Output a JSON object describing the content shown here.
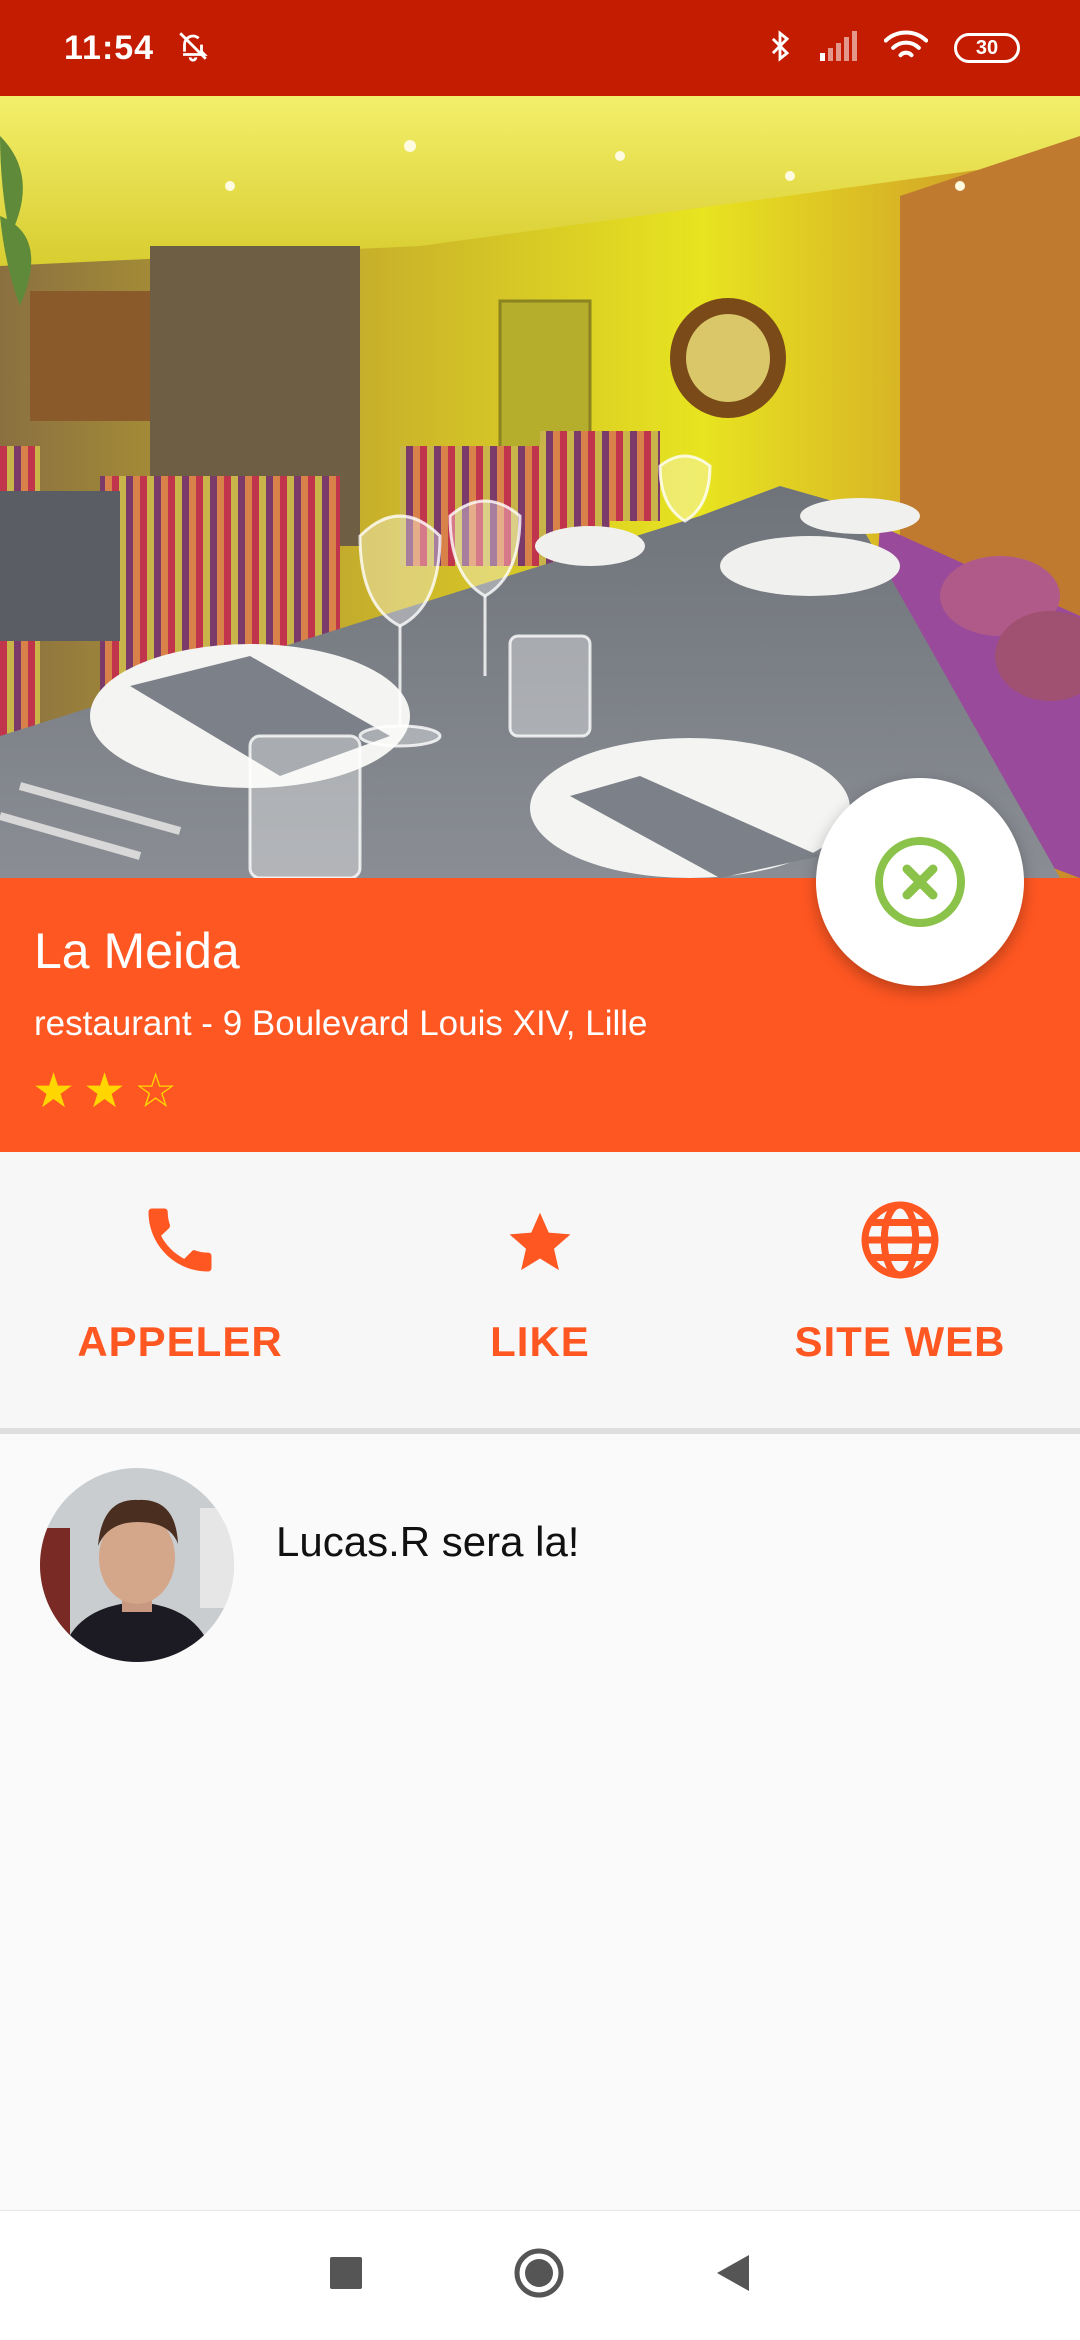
{
  "status_bar": {
    "time": "11:54",
    "battery": "30",
    "icons": [
      "alarm-off-icon",
      "bluetooth-icon",
      "signal-icon",
      "wifi-icon",
      "battery-icon"
    ]
  },
  "place": {
    "name": "La Meida",
    "address": "restaurant - 9 Boulevard Louis XIV, Lille",
    "rating": 2,
    "rating_max": 3
  },
  "actions": [
    {
      "label": "APPELER",
      "icon": "phone-icon"
    },
    {
      "label": "LIKE",
      "icon": "star-icon"
    },
    {
      "label": "SITE WEB",
      "icon": "globe-icon"
    }
  ],
  "attendees": [
    {
      "text": "Lucas.R sera la!"
    }
  ],
  "navigation": {
    "icons": [
      "recents-icon",
      "home-icon",
      "back-icon"
    ]
  },
  "colors": {
    "status_bar": "#c41c00",
    "accent": "#ff5722",
    "star": "#ffd600",
    "fab_icon": "#8bc34a"
  }
}
